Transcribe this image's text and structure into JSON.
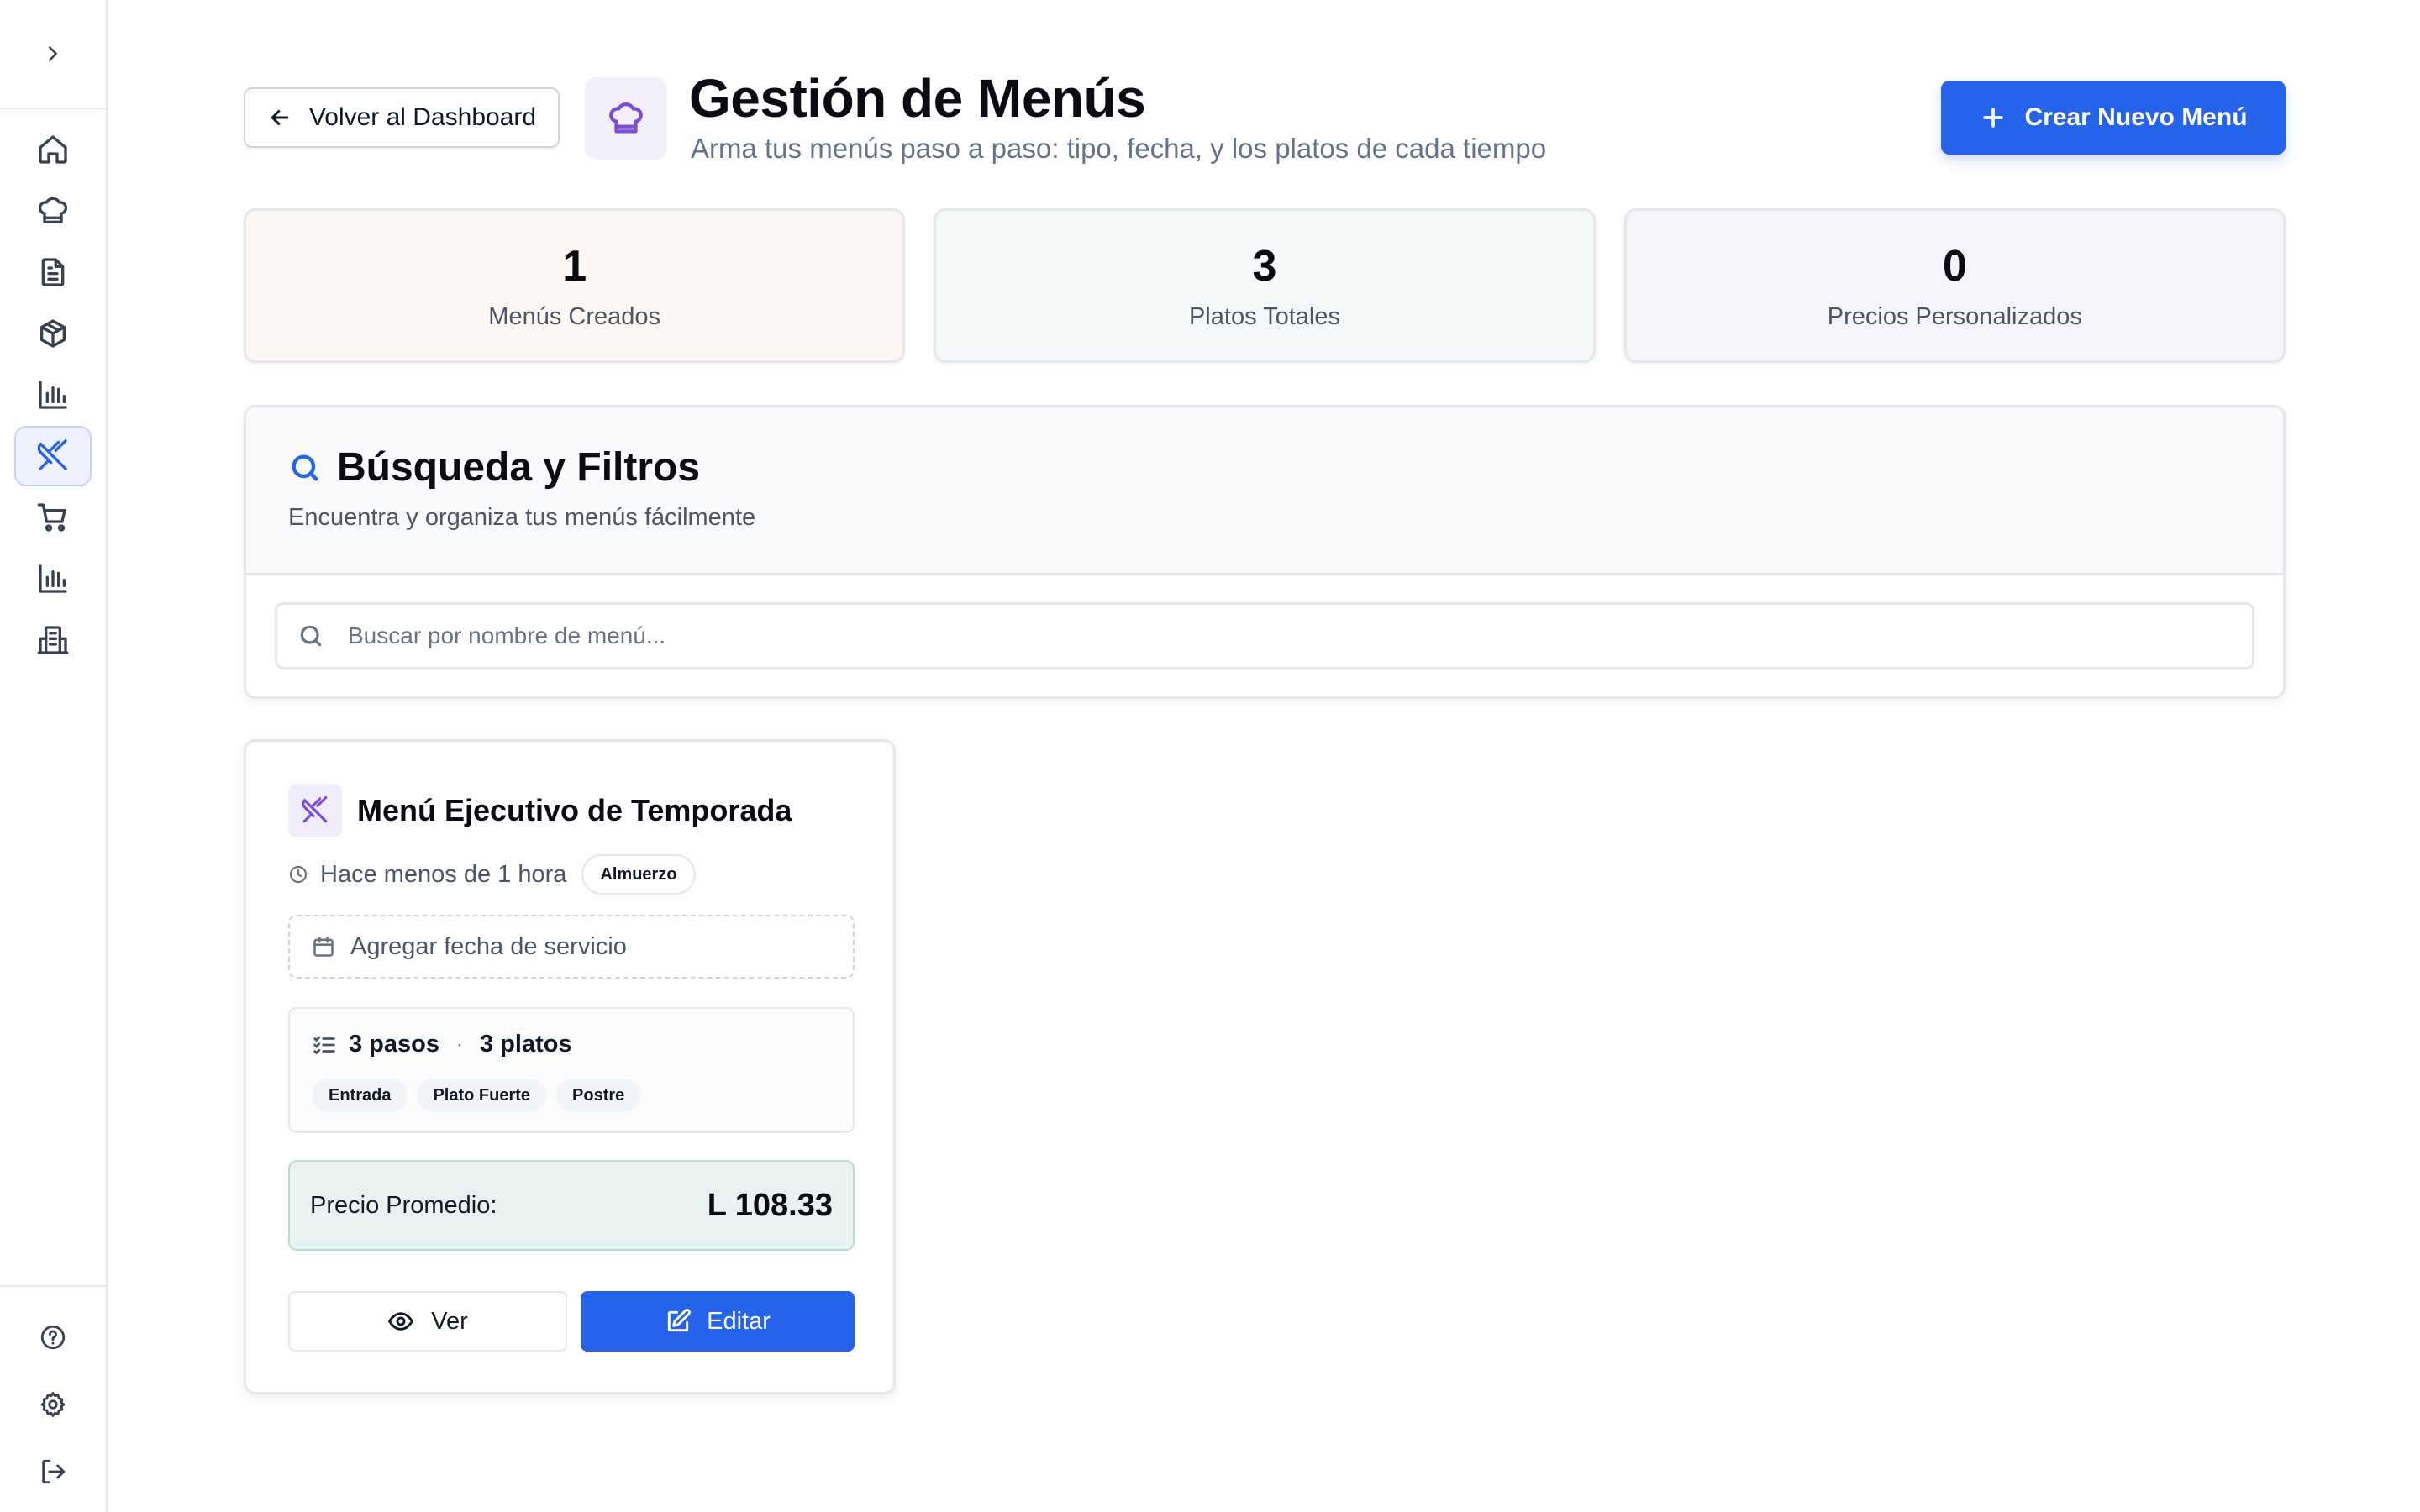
{
  "sidebar": {
    "toggle_icon": "chevron-right-icon",
    "nav": [
      {
        "icon": "home-icon",
        "active": false
      },
      {
        "icon": "chef-hat-icon",
        "active": false
      },
      {
        "icon": "document-icon",
        "active": false
      },
      {
        "icon": "package-icon",
        "active": false
      },
      {
        "icon": "bar-chart-icon",
        "active": false
      },
      {
        "icon": "utensils-crossed-icon",
        "active": true
      },
      {
        "icon": "shopping-cart-icon",
        "active": false
      },
      {
        "icon": "bar-chart-icon",
        "active": false
      },
      {
        "icon": "building-icon",
        "active": false
      }
    ],
    "bottom": [
      {
        "icon": "help-circle-icon"
      },
      {
        "icon": "settings-gear-icon"
      },
      {
        "icon": "log-out-icon"
      }
    ]
  },
  "header": {
    "back_label": "Volver al Dashboard",
    "title": "Gestión de Menús",
    "subtitle": "Arma tus menús paso a paso: tipo, fecha, y los platos de cada tiempo",
    "create_label": "Crear Nuevo Menú"
  },
  "stats": [
    {
      "value": "1",
      "label": "Menús Creados"
    },
    {
      "value": "3",
      "label": "Platos Totales"
    },
    {
      "value": "0",
      "label": "Precios Personalizados"
    }
  ],
  "search": {
    "title": "Búsqueda y Filtros",
    "description": "Encuentra y organiza tus menús fácilmente",
    "placeholder": "Buscar por nombre de menú..."
  },
  "menus": [
    {
      "title": "Menú Ejecutivo de Temporada",
      "time": "Hace menos de 1 hora",
      "type": "Almuerzo",
      "date_prompt": "Agregar fecha de servicio",
      "steps": "3 pasos",
      "separator": "·",
      "dishes": "3 platos",
      "tags": [
        "Entrada",
        "Plato Fuerte",
        "Postre"
      ],
      "price_label": "Precio Promedio:",
      "price_value": "L 108.33",
      "view_label": "Ver",
      "edit_label": "Editar"
    }
  ],
  "colors": {
    "primary": "#2563eb",
    "accent_purple": "#7c4ddb",
    "price_bg": "#e8f3f1"
  }
}
